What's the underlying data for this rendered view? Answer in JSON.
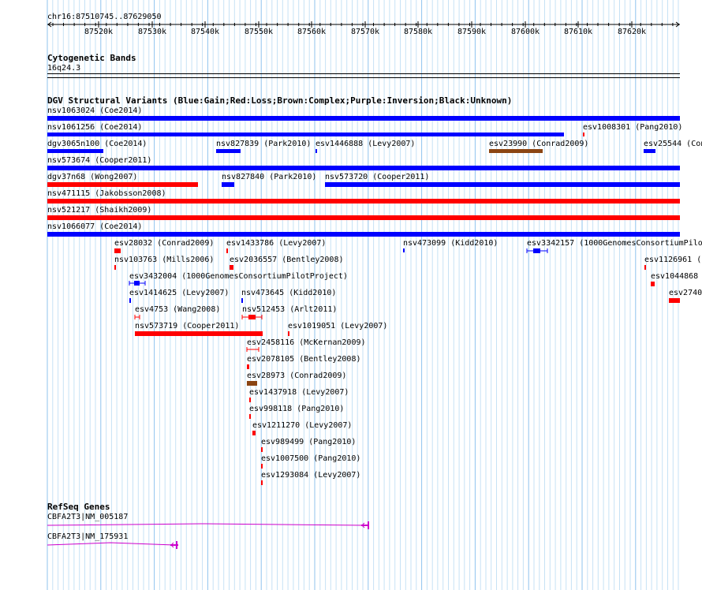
{
  "ruler": {
    "range_label": "chr16:87510745..87629050",
    "ticks": [
      "87520k",
      "87530k",
      "87540k",
      "87550k",
      "87560k",
      "87570k",
      "87580k",
      "87590k",
      "87600k",
      "87610k",
      "87620k"
    ]
  },
  "cyto": {
    "title": "Cytogenetic Bands",
    "band": "16q24.3"
  },
  "dgv": {
    "title": "DGV Structural Variants (Blue:Gain;Red:Loss;Brown:Complex;Purple:Inversion;Black:Unknown)",
    "colors": {
      "gain": "#0000ff",
      "loss": "#ff0000",
      "complex": "#8b4513"
    },
    "features": [
      {
        "label": "nsv1063024 (Coe2014)",
        "type": "gain"
      },
      {
        "label": "nsv1061256 (Coe2014)",
        "type": "gain"
      },
      {
        "label": "esv1008301 (Pang2010)",
        "type": "loss"
      },
      {
        "label": "dgv3065n100 (Coe2014)",
        "type": "gain"
      },
      {
        "label": "nsv827839 (Park2010)",
        "type": "gain"
      },
      {
        "label": "esv1446888 (Levy2007)",
        "type": "gain"
      },
      {
        "label": "esv23990 (Conrad2009)",
        "type": "complex"
      },
      {
        "label": "esv25544 (Con",
        "type": "gain"
      },
      {
        "label": "nsv573674 (Cooper2011)",
        "type": "gain"
      },
      {
        "label": "dgv37n68 (Wong2007)",
        "type": "loss"
      },
      {
        "label": "nsv827840 (Park2010)",
        "type": "gain"
      },
      {
        "label": "nsv573720 (Cooper2011)",
        "type": "gain"
      },
      {
        "label": "nsv471115 (Jakobsson2008)",
        "type": "loss"
      },
      {
        "label": "nsv521217 (Shaikh2009)",
        "type": "loss"
      },
      {
        "label": "nsv1066077 (Coe2014)",
        "type": "gain"
      },
      {
        "label": "esv28032 (Conrad2009)",
        "type": "loss"
      },
      {
        "label": "esv1433786 (Levy2007)",
        "type": "loss"
      },
      {
        "label": "nsv473099 (Kidd2010)",
        "type": "gain"
      },
      {
        "label": "esv3342157 (1000GenomesConsortiumPilo",
        "type": "gain"
      },
      {
        "label": "nsv103763 (Mills2006)",
        "type": "loss"
      },
      {
        "label": "esv2036557 (Bentley2008)",
        "type": "loss"
      },
      {
        "label": "esv1126961 (",
        "type": "loss"
      },
      {
        "label": "esv3432004 (1000GenomesConsortiumPilotProject)",
        "type": "gain"
      },
      {
        "label": "esv1044868",
        "type": "loss"
      },
      {
        "label": "esv1414625 (Levy2007)",
        "type": "gain"
      },
      {
        "label": "nsv473645 (Kidd2010)",
        "type": "gain"
      },
      {
        "label": "esv2740",
        "type": "loss"
      },
      {
        "label": "esv4753 (Wang2008)",
        "type": "loss"
      },
      {
        "label": "nsv512453 (Arlt2011)",
        "type": "loss"
      },
      {
        "label": "nsv573719 (Cooper2011)",
        "type": "loss"
      },
      {
        "label": "esv1019051 (Levy2007)",
        "type": "loss"
      },
      {
        "label": "esv2458116 (McKernan2009)",
        "type": "loss"
      },
      {
        "label": "esv2078105 (Bentley2008)",
        "type": "loss"
      },
      {
        "label": "esv28973 (Conrad2009)",
        "type": "complex"
      },
      {
        "label": "esv1437918 (Levy2007)",
        "type": "loss"
      },
      {
        "label": "esv998118 (Pang2010)",
        "type": "loss"
      },
      {
        "label": "esv1211270 (Levy2007)",
        "type": "loss"
      },
      {
        "label": "esv989499 (Pang2010)",
        "type": "loss"
      },
      {
        "label": "esv1007500 (Pang2010)",
        "type": "loss"
      },
      {
        "label": "esv1293084 (Levy2007)",
        "type": "loss"
      }
    ]
  },
  "refseq": {
    "title": "RefSeq Genes",
    "genes": [
      "CBFA2T3|NM_005187",
      "CBFA2T3|NM_175931"
    ],
    "color": "#cc00cc"
  }
}
